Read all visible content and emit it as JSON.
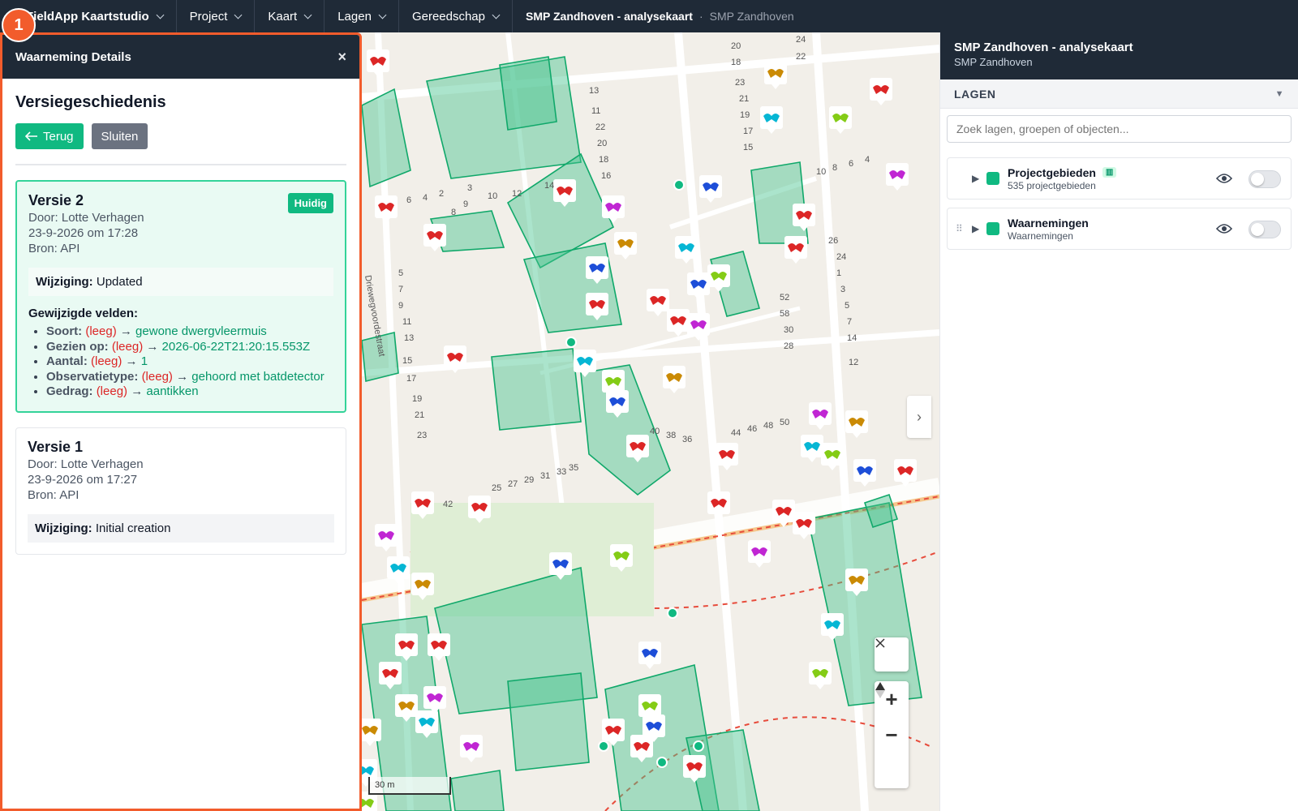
{
  "topbar": {
    "brand": "FieldApp Kaartstudio",
    "menus": [
      "Project",
      "Kaart",
      "Lagen",
      "Gereedschap"
    ],
    "project_title": "SMP Zandhoven - analysekaart",
    "project_sub": "SMP Zandhoven",
    "separator": "·"
  },
  "step_badge": "1",
  "left_panel": {
    "title": "Waarneming Details",
    "close": "×",
    "heading": "Versiegeschiedenis",
    "back_label": "Terug",
    "close_label": "Sluiten",
    "versions": [
      {
        "title": "Versie 2",
        "badge": "Huidig",
        "author": "Door: Lotte Verhagen",
        "date": "23-9-2026 om 17:28",
        "source": "Bron: API",
        "change_label": "Wijziging:",
        "change_value": "Updated",
        "fields_title": "Gewijzigde velden:",
        "fields": [
          {
            "name": "Soort:",
            "old": "(leeg)",
            "arrow": "→",
            "new": "gewone dwergvleermuis"
          },
          {
            "name": "Gezien op:",
            "old": "(leeg)",
            "arrow": "→",
            "new": "2026-06-22T21:20:15.553Z"
          },
          {
            "name": "Aantal:",
            "old": "(leeg)",
            "arrow": "→",
            "new": "1"
          },
          {
            "name": "Observatietype:",
            "old": "(leeg)",
            "arrow": "→",
            "new": "gehoord met batdetector"
          },
          {
            "name": "Gedrag:",
            "old": "(leeg)",
            "arrow": "→",
            "new": "aantikken"
          }
        ]
      },
      {
        "title": "Versie 1",
        "author": "Door: Lotte Verhagen",
        "date": "23-9-2026 om 17:27",
        "source": "Bron: API",
        "change_label": "Wijziging:",
        "change_value": "Initial creation"
      }
    ]
  },
  "map": {
    "scale_label": "30 m",
    "street_label": "Driewegvoordestraat",
    "zoom_in": "+",
    "zoom_out": "−",
    "house_numbers": [
      "24",
      "22",
      "20",
      "18",
      "23",
      "21",
      "19",
      "17",
      "15",
      "13",
      "11",
      "22",
      "20",
      "18",
      "16",
      "14",
      "12",
      "10",
      "9",
      "8",
      "6",
      "4",
      "2",
      "3",
      "5",
      "7",
      "9",
      "11",
      "13",
      "15",
      "17",
      "19",
      "21",
      "23",
      "25",
      "27",
      "29",
      "31",
      "33",
      "35",
      "36",
      "38",
      "40",
      "42",
      "44",
      "46",
      "48",
      "50",
      "52",
      "58",
      "30",
      "28",
      "26",
      "24",
      "1",
      "3",
      "5",
      "7",
      "14",
      "12",
      "10",
      "8",
      "6",
      "4",
      "2",
      "16",
      "18",
      "20"
    ]
  },
  "right_panel": {
    "title": "SMP Zandhoven - analysekaart",
    "subtitle": "SMP Zandhoven",
    "section": "LAGEN",
    "section_arrow": "▼",
    "search_placeholder": "Zoek lagen, groepen of objecten...",
    "layers": [
      {
        "name": "Projectgebieden",
        "sub": "535 projectgebieden",
        "color": "#10b981"
      },
      {
        "name": "Waarnemingen",
        "sub": "Waarnemingen",
        "color": "#10b981"
      }
    ]
  }
}
